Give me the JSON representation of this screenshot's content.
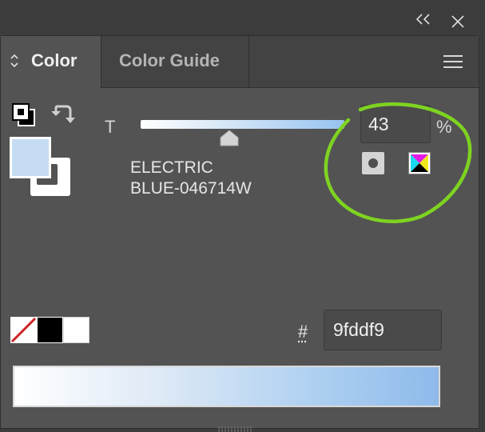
{
  "panel": {
    "tabs": [
      {
        "label": "Color",
        "active": true
      },
      {
        "label": "Color Guide",
        "active": false
      }
    ]
  },
  "icons": {
    "collapse": "double-chevron-left-icon",
    "close": "close-icon",
    "tab_sort": "up-down-arrows-icon",
    "panel_menu": "hamburger-menu-icon",
    "swap": "swap-fill-stroke-arrow-icon",
    "default_colors": "default-fill-stroke-icon",
    "global": "global-color-icon",
    "spot": "spot-color-icon"
  },
  "colors": {
    "fill": "#c6dcf2",
    "stroke": "#ffffff",
    "annotation": "#7ed321",
    "spectrum_end": "#8fbaeb"
  },
  "tint": {
    "label": "T",
    "value": "43",
    "unit": "%",
    "level_percent": 43
  },
  "swatch": {
    "name_line1": "ELECTRIC",
    "name_line2": "BLUE-046714W"
  },
  "hex": {
    "label": "#",
    "value": "9fddf9"
  },
  "quick_swatches": [
    "none",
    "black",
    "white"
  ]
}
